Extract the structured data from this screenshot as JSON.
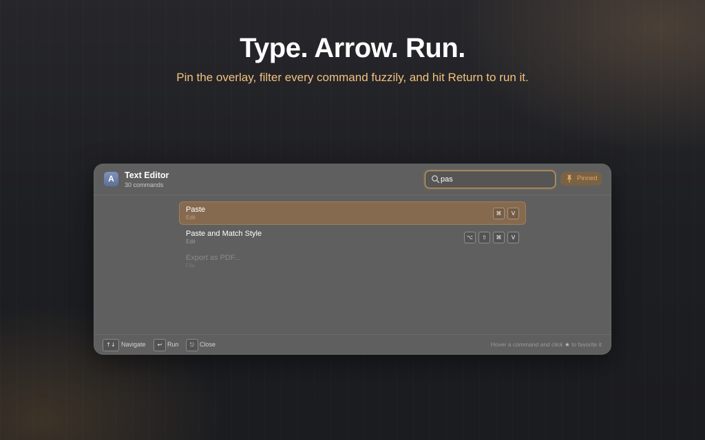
{
  "hero": {
    "headline": "Type. Arrow. Run.",
    "subline": "Pin the overlay, filter every command fuzzily, and hit Return to run it."
  },
  "palette": {
    "app_icon_letter": "A",
    "app_title": "Text Editor",
    "command_count": "30 commands",
    "search": {
      "value": "pas",
      "icon": "search-icon"
    },
    "pinned_label": "Pinned",
    "pinned_icon": "pin-icon",
    "items": [
      {
        "title": "Paste",
        "category": "Edit",
        "shortcut": [
          "⌘",
          "V"
        ],
        "selected": true
      },
      {
        "title": "Paste and Match Style",
        "category": "Edit",
        "shortcut": [
          "⌥",
          "⇧",
          "⌘",
          "V"
        ],
        "selected": false
      },
      {
        "title": "Export as PDF...",
        "category": "File",
        "shortcut": [],
        "selected": false
      }
    ],
    "footer": {
      "navigate_key": "↑↓",
      "navigate_label": "Navigate",
      "run_key": "↩",
      "run_label": "Run",
      "close_key": "⎋",
      "close_label": "Close",
      "hint_before": "Hover a command and click",
      "hint_star": "★",
      "hint_after": "to favorite it"
    }
  },
  "colors": {
    "accent": "#d7a05a",
    "subline": "#f3c27e",
    "panel": "#5f5f5f",
    "selected_row": "#866a4f",
    "pinned_bg": "#7a6246"
  }
}
